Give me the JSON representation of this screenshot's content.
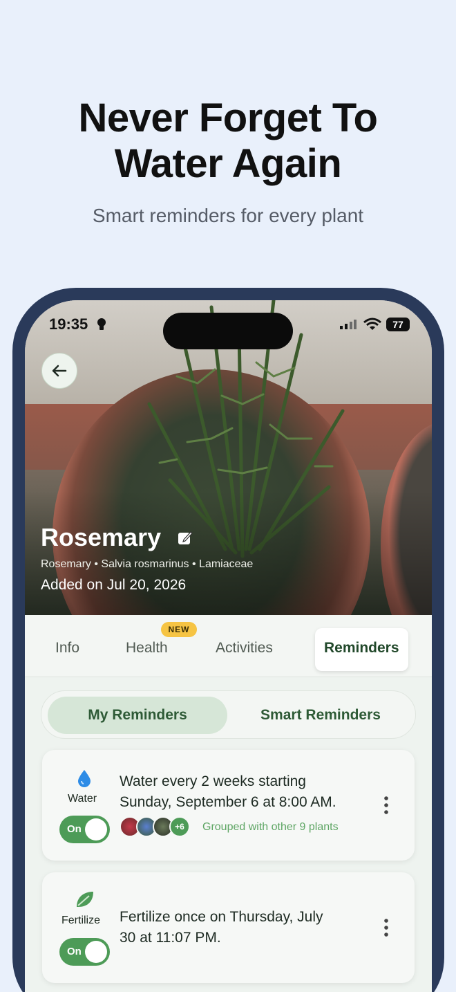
{
  "promo": {
    "headline_line1": "Never Forget To",
    "headline_line2": "Water Again",
    "subheadline": "Smart reminders for every plant"
  },
  "status_bar": {
    "time": "19:35",
    "battery": "77"
  },
  "plant": {
    "name": "Rosemary",
    "meta": "Rosemary • Salvia rosmarinus • Lamiaceae",
    "added": "Added on Jul 20, 2026"
  },
  "tabs": [
    {
      "label": "Info"
    },
    {
      "label": "Health",
      "badge": "NEW"
    },
    {
      "label": "Activities"
    },
    {
      "label": "Reminders",
      "active": true
    }
  ],
  "segmented": {
    "options": [
      "My Reminders",
      "Smart Reminders"
    ],
    "selected": "My Reminders"
  },
  "reminders": [
    {
      "kind": "Water",
      "icon": "water-drop-icon",
      "toggle": "On",
      "description": "Water every 2 weeks starting Sunday, September 6 at 8:00 AM.",
      "desc_line1": "Water every 2 weeks starting",
      "desc_line2": "Sunday, September 6 at 8:00 AM.",
      "group_more": "+6",
      "grouped_text": "Grouped with other 9 plants"
    },
    {
      "kind": "Fertilize",
      "icon": "leaf-icon",
      "toggle": "On",
      "desc_line1": "Fertilize once on Thursday, July",
      "desc_line2": "30 at 11:07 PM."
    }
  ],
  "colors": {
    "accent_green": "#4d9b57",
    "tab_active_text": "#21482a",
    "badge_yellow": "#f6c443",
    "water_blue": "#2d8ce6",
    "page_bg": "#e9f0fb",
    "phone_frame": "#2a3a5a"
  }
}
